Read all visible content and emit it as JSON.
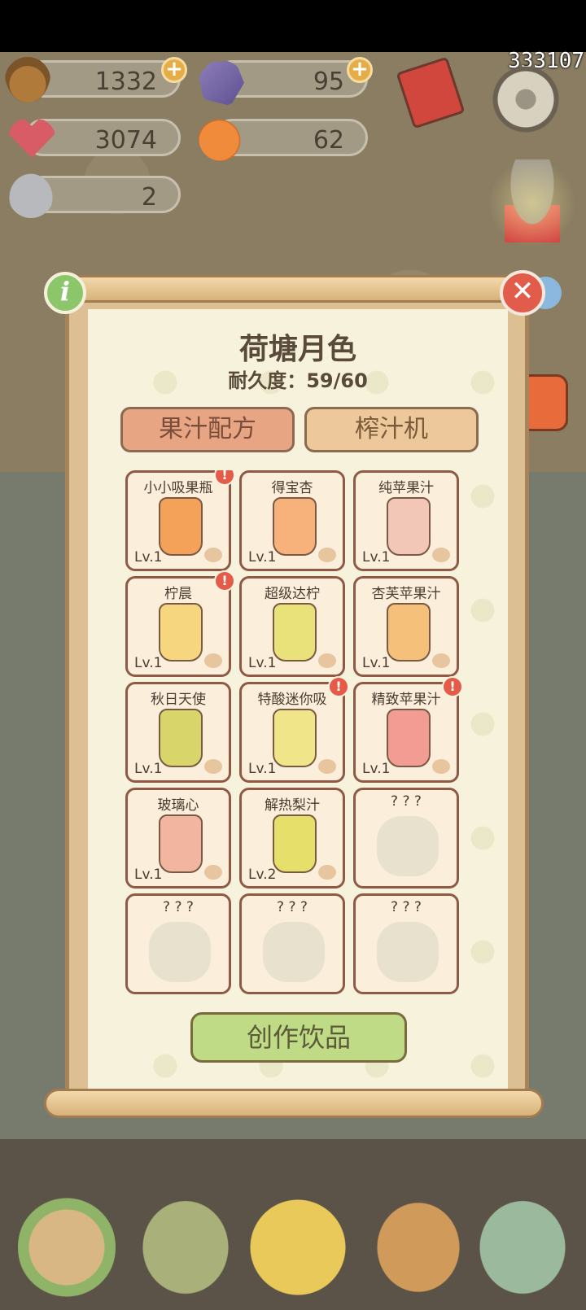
{
  "corner_id": "333107",
  "resources": {
    "acorn": "1332",
    "crystal": "95",
    "heart": "3074",
    "orange": "62",
    "robot": "2"
  },
  "panel": {
    "title": "荷塘月色",
    "durability": "耐久度：59/60",
    "tabs": [
      "果汁配方",
      "榨汁机"
    ],
    "info_glyph": "i",
    "close_glyph": "✕",
    "create_button": "创作饮品"
  },
  "recipes": [
    {
      "name": "小小吸果瓶",
      "level": "Lv.1",
      "alert": true,
      "color": "#f4a25a",
      "locked": false
    },
    {
      "name": "得宝杏",
      "level": "Lv.1",
      "alert": false,
      "color": "#f6b27a",
      "locked": false
    },
    {
      "name": "纯苹果汁",
      "level": "Lv.1",
      "alert": false,
      "color": "#f3c7b8",
      "locked": false
    },
    {
      "name": "柠晨",
      "level": "Lv.1",
      "alert": true,
      "color": "#f7d680",
      "locked": false
    },
    {
      "name": "超级达柠",
      "level": "Lv.1",
      "alert": false,
      "color": "#e9e27a",
      "locked": false
    },
    {
      "name": "杏芙苹果汁",
      "level": "Lv.1",
      "alert": false,
      "color": "#f5c07a",
      "locked": false
    },
    {
      "name": "秋日天使",
      "level": "Lv.1",
      "alert": false,
      "color": "#d8d66a",
      "locked": false
    },
    {
      "name": "特酸迷你吸",
      "level": "Lv.1",
      "alert": true,
      "color": "#f1e58a",
      "locked": false
    },
    {
      "name": "精致苹果汁",
      "level": "Lv.1",
      "alert": true,
      "color": "#f39c94",
      "locked": false
    },
    {
      "name": "玻璃心",
      "level": "Lv.1",
      "alert": false,
      "color": "#f2b6a0",
      "locked": false
    },
    {
      "name": "解热梨汁",
      "level": "Lv.2",
      "alert": false,
      "color": "#e6e06a",
      "locked": false
    },
    {
      "name": "? ? ?",
      "level": "",
      "alert": false,
      "color": "#e8e1ce",
      "locked": true
    },
    {
      "name": "? ? ?",
      "level": "",
      "alert": false,
      "color": "#e8e1ce",
      "locked": true
    },
    {
      "name": "? ? ?",
      "level": "",
      "alert": false,
      "color": "#e8e1ce",
      "locked": true
    },
    {
      "name": "? ? ?",
      "level": "",
      "alert": false,
      "color": "#e8e1ce",
      "locked": true
    }
  ],
  "nav": [
    {
      "icon": "house-icon"
    },
    {
      "icon": "mail-icon"
    },
    {
      "icon": "eggs-icon"
    },
    {
      "icon": "task-list-icon"
    },
    {
      "icon": "map-icon"
    }
  ]
}
